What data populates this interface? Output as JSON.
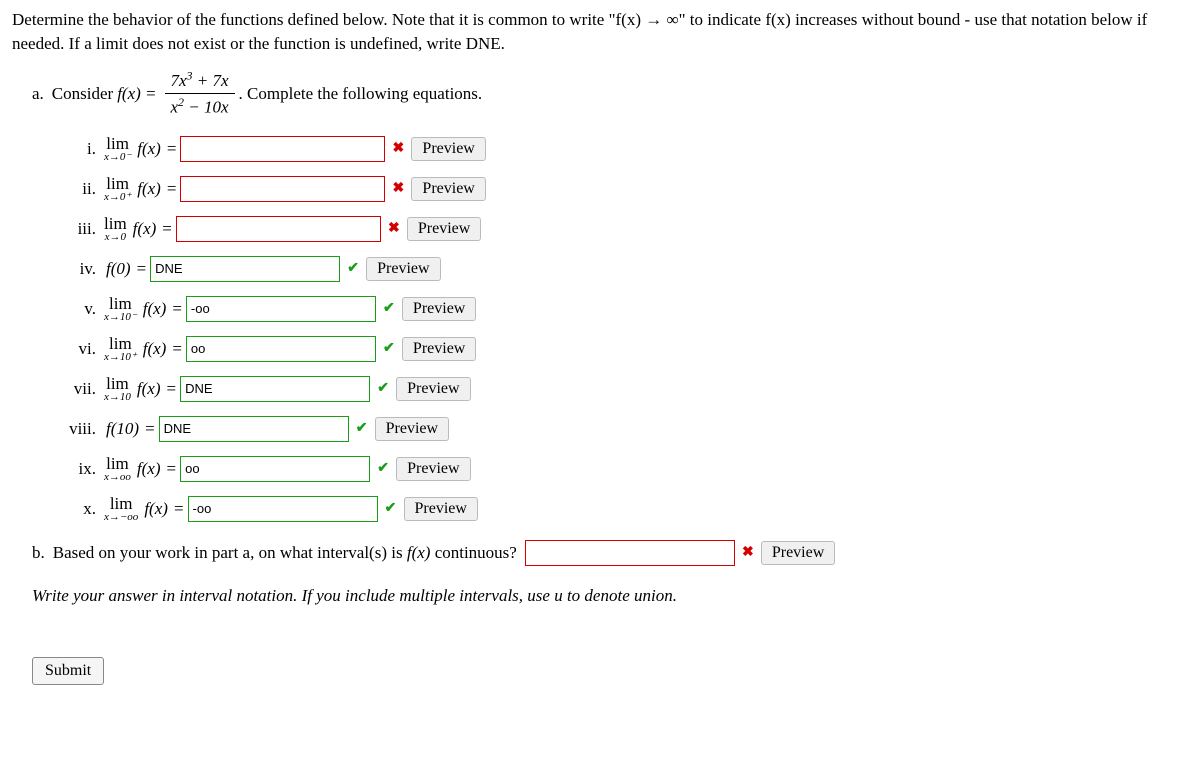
{
  "intro": "Determine the behavior of the functions defined below. Note that it is common to write \"f(x) → ∞\" to indicate f(x) increases without bound - use that notation below if needed. If a limit does not exist or the function is undefined, write DNE.",
  "part_a": {
    "label": "a.",
    "text_before": "Consider ",
    "func": "f(x) =",
    "numer": "7x³ + 7x",
    "denom": "x² − 10x",
    "text_after": ". Complete the following equations."
  },
  "items": [
    {
      "roman": "i.",
      "lhs": "lim",
      "sub": "x→0⁻",
      "fx": "f(x)",
      "input_w": 195,
      "value": "",
      "status": "wrong",
      "preview": "Preview"
    },
    {
      "roman": "ii.",
      "lhs": "lim",
      "sub": "x→0⁺",
      "fx": "f(x)",
      "input_w": 195,
      "value": "",
      "status": "wrong",
      "preview": "Preview"
    },
    {
      "roman": "iii.",
      "lhs": "lim",
      "sub": "x→0",
      "fx": "f(x)",
      "input_w": 195,
      "value": "",
      "status": "wrong",
      "preview": "Preview"
    },
    {
      "roman": "iv.",
      "lhs": "",
      "sub": "",
      "fx": "f(0)",
      "input_w": 180,
      "value": "DNE",
      "status": "right",
      "preview": "Preview"
    },
    {
      "roman": "v.",
      "lhs": "lim",
      "sub": "x→10⁻",
      "fx": "f(x)",
      "input_w": 180,
      "value": "-oo",
      "status": "right",
      "preview": "Preview"
    },
    {
      "roman": "vi.",
      "lhs": "lim",
      "sub": "x→10⁺",
      "fx": "f(x)",
      "input_w": 180,
      "value": "oo",
      "status": "right",
      "preview": "Preview"
    },
    {
      "roman": "vii.",
      "lhs": "lim",
      "sub": "x→10",
      "fx": "f(x)",
      "input_w": 180,
      "value": "DNE",
      "status": "right",
      "preview": "Preview"
    },
    {
      "roman": "viii.",
      "lhs": "",
      "sub": "",
      "fx": "f(10)",
      "input_w": 180,
      "value": "DNE",
      "status": "right",
      "preview": "Preview"
    },
    {
      "roman": "ix.",
      "lhs": "lim",
      "sub": "x→oo",
      "fx": "f(x)",
      "input_w": 180,
      "value": "oo",
      "status": "right",
      "preview": "Preview"
    },
    {
      "roman": "x.",
      "lhs": "lim",
      "sub": "x→−oo",
      "fx": "f(x)",
      "input_w": 180,
      "value": "-oo",
      "status": "right",
      "preview": "Preview"
    }
  ],
  "part_b": {
    "label": "b.",
    "text": "Based on your work in part a, on what interval(s) is f(x) continuous?",
    "value": "",
    "status": "wrong",
    "preview": "Preview"
  },
  "hint": "Write your answer in interval notation. If you include multiple intervals, use u to denote union.",
  "submit": "Submit"
}
